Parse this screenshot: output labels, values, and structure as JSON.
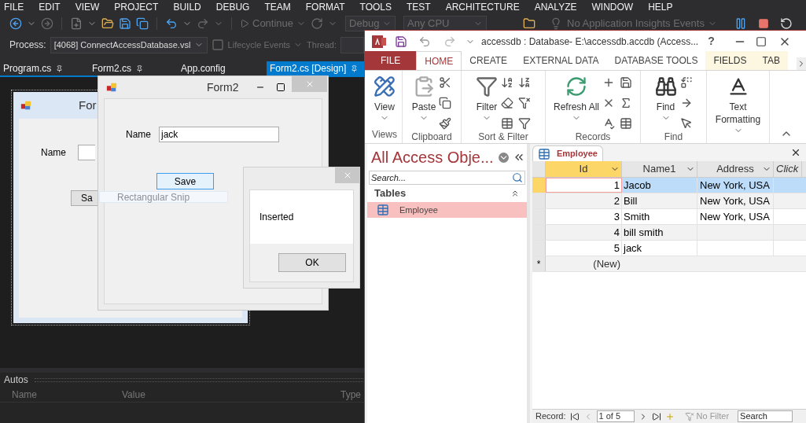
{
  "vs": {
    "menu": [
      "FILE",
      "EDIT",
      "VIEW",
      "PROJECT",
      "BUILD",
      "DEBUG",
      "TEAM",
      "FORMAT",
      "TOOLS",
      "TEST",
      "ARCHITECTURE",
      "ANALYZE",
      "WINDOW",
      "HELP"
    ],
    "toolbar": {
      "continue": "Continue",
      "configuration": "Debug",
      "platform": "Any CPU",
      "insights": "No Application Insights Events"
    },
    "debug_location": {
      "process_label": "Process:",
      "process": "[4068] ConnectAccessDatabase.vsl",
      "lifecycle": "Lifecycle Events",
      "thread_label": "Thread:"
    },
    "doc_tabs": [
      {
        "label": "Program.cs",
        "pinned": true,
        "selected": false
      },
      {
        "label": "Form2.cs",
        "pinned": true,
        "selected": false
      },
      {
        "label": "App.config",
        "pinned": false,
        "selected": false
      },
      {
        "label": "Form2.cs [Design]",
        "pinned": true,
        "selected": true
      }
    ],
    "designer_form": {
      "title": "For",
      "name_label": "Name",
      "button": "Sa"
    },
    "autos": {
      "title": "Autos",
      "columns": [
        "Name",
        "Value",
        "Type"
      ]
    }
  },
  "snip_overlay": "Rectangular Snip",
  "form2": {
    "title": "Form2",
    "name_label": "Name",
    "name_value": "jack",
    "button": "Save"
  },
  "message_box": {
    "text": "Inserted",
    "button": "OK"
  },
  "access": {
    "title": "accessdb : Database- E:\\accessdb.accdb (Access...",
    "help": "?",
    "ribbon_tabs": [
      {
        "label": "FILE",
        "kind": "file",
        "selected": false
      },
      {
        "label": "HOME",
        "kind": "tab",
        "selected": true
      },
      {
        "label": "CREATE",
        "kind": "tab",
        "selected": false
      },
      {
        "label": "EXTERNAL DATA",
        "kind": "tab",
        "selected": false
      },
      {
        "label": "DATABASE TOOLS",
        "kind": "tab",
        "selected": false
      },
      {
        "label": "FIELDS",
        "kind": "context",
        "selected": false
      },
      {
        "label": "TAB",
        "kind": "context",
        "selected": false
      }
    ],
    "groups": [
      {
        "kind": "views",
        "large": "View",
        "label": "Views"
      },
      {
        "kind": "clipboard",
        "large": "Paste",
        "label": "Clipboard"
      },
      {
        "kind": "sort",
        "large": "Filter",
        "label": "Sort & Filter"
      },
      {
        "kind": "records",
        "large": "Refresh All",
        "label": "Records"
      },
      {
        "kind": "find",
        "large": "Find",
        "label": "Find"
      },
      {
        "kind": "format",
        "large": "Text Formatting"
      }
    ],
    "nav": {
      "title": "All Access Obje...",
      "search_placeholder": "Search...",
      "section": "Tables",
      "items": [
        {
          "label": "Employee",
          "selected": true
        }
      ]
    },
    "datasheet": {
      "tab": "Employee",
      "columns": [
        {
          "label": "Id",
          "kind": "field",
          "selected": true
        },
        {
          "label": "Name1",
          "kind": "field",
          "selected": false
        },
        {
          "label": "Address",
          "kind": "field",
          "selected": false
        },
        {
          "label": "Click",
          "kind": "add",
          "selected": false
        }
      ],
      "rows": [
        {
          "id": "1",
          "name": "Jacob",
          "address": "New York, USA",
          "selected": true
        },
        {
          "id": "2",
          "name": "Bill",
          "address": "New York, USA",
          "selected": false
        },
        {
          "id": "3",
          "name": "Smith",
          "address": "New York, USA",
          "selected": false
        },
        {
          "id": "4",
          "name": "bill smith",
          "selected": false
        },
        {
          "id": "5",
          "name": "jack",
          "selected": false
        }
      ],
      "new_row": {
        "marker": "*",
        "id": "(New)"
      }
    },
    "record_bar": {
      "label": "Record:",
      "position": "1 of 5",
      "filter": "No Filter",
      "search_placeholder": "Search"
    }
  }
}
